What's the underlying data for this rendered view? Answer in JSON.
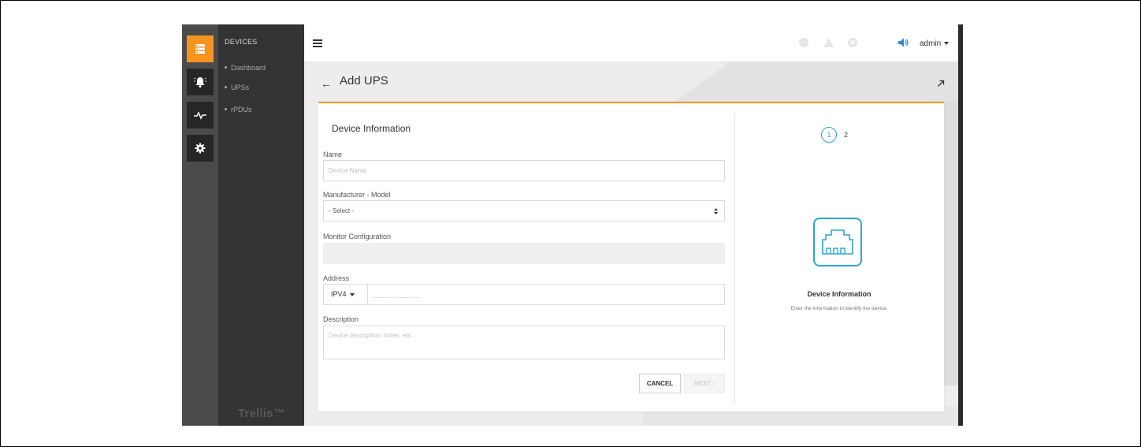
{
  "sidebar": {
    "section_title": "DEVICES",
    "items": [
      {
        "label": "Dashboard"
      },
      {
        "label": "UPSs"
      },
      {
        "label": "rPDUs"
      }
    ],
    "brand": "Trellis™"
  },
  "rail": {
    "icons": [
      "devices-icon",
      "alarm-bell-icon",
      "activity-pulse-icon",
      "settings-gear-icon"
    ],
    "active_color": "#f7941d"
  },
  "topbar": {
    "user": "admin",
    "status_icons": [
      "status-circle-icon",
      "warning-triangle-icon",
      "error-circle-icon",
      "speaker-icon"
    ]
  },
  "page": {
    "title": "Add UPS"
  },
  "form": {
    "section_title": "Device Information",
    "name": {
      "label": "Name",
      "placeholder": "Device Name",
      "value": ""
    },
    "model": {
      "label": "Manufacturer - Model",
      "value": "- Select -"
    },
    "monitor": {
      "label": "Monitor Configuration",
      "value": ""
    },
    "address": {
      "label": "Address",
      "type": "IPV4",
      "value": "___.___.___.___"
    },
    "description": {
      "label": "Description",
      "placeholder": "Device description, notes, etc..."
    },
    "cancel_label": "CANCEL",
    "next_label": "NEXT ›"
  },
  "stepper": {
    "current": "1",
    "next": "2",
    "accent": "#2aa6d3"
  },
  "info_panel": {
    "title": "Device Information",
    "description": "Enter the information to identify the device."
  }
}
